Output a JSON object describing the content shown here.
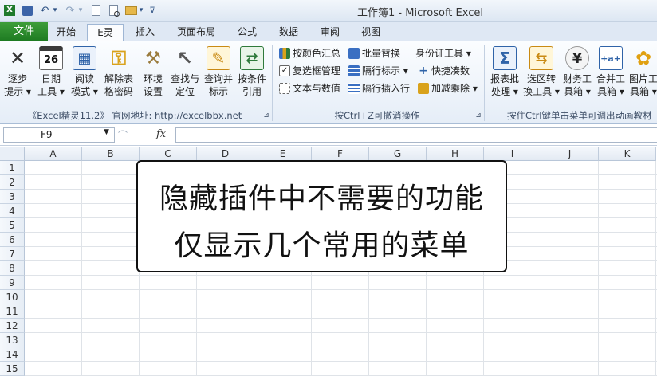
{
  "window": {
    "title": "工作簿1 - Microsoft Excel"
  },
  "quick_access": {
    "dropdown_glyph": "▾"
  },
  "tabs": [
    {
      "id": "file",
      "label": "文件"
    },
    {
      "id": "home",
      "label": "开始"
    },
    {
      "id": "elite",
      "label": "E灵"
    },
    {
      "id": "insert",
      "label": "插入"
    },
    {
      "id": "layout",
      "label": "页面布局"
    },
    {
      "id": "formula",
      "label": "公式"
    },
    {
      "id": "data",
      "label": "数据"
    },
    {
      "id": "review",
      "label": "审阅"
    },
    {
      "id": "view",
      "label": "视图"
    }
  ],
  "ribbon": {
    "big_buttons": [
      {
        "l1": "逐步",
        "l2": "提示 ▾",
        "icon": "x-mark-icon",
        "glyph": "✕",
        "color": "#333333"
      },
      {
        "l1": "日期",
        "l2": "工具 ▾",
        "icon": "calendar-icon",
        "glyph": "26",
        "color": "#333333"
      },
      {
        "l1": "阅读",
        "l2": "模式 ▾",
        "icon": "reading-icon",
        "glyph": "▦",
        "color": "#2f63a8"
      },
      {
        "l1": "解除表",
        "l2": "格密码",
        "icon": "key-icon",
        "glyph": "⚿",
        "color": "#d9a21c"
      },
      {
        "l1": "环境",
        "l2": "设置",
        "icon": "tools-icon",
        "glyph": "⚒",
        "color": "#9a7b3d"
      },
      {
        "l1": "查找与",
        "l2": "定位",
        "icon": "cursor-icon",
        "glyph": "↖",
        "color": "#555555"
      },
      {
        "l1": "查询并",
        "l2": "标示",
        "icon": "pencil-note-icon",
        "glyph": "✎",
        "color": "#c98a13"
      },
      {
        "l1": "按条件",
        "l2": "引用",
        "icon": "reference-icon",
        "glyph": "⇄",
        "color": "#2f7a3b"
      }
    ],
    "small_buttons": [
      {
        "label": "按颜色汇总",
        "icon": "color-sum-icon",
        "color": "#3a6fc2"
      },
      {
        "label": "复选框管理",
        "icon": "checkbox-icon",
        "color": "#ffffff"
      },
      {
        "label": "文本与数值",
        "icon": "text-number-icon",
        "color": "#ffffff"
      },
      {
        "label": "批量替换",
        "icon": "batch-replace-icon",
        "color": "#3a6fc2"
      },
      {
        "label": "隔行标示 ▾",
        "icon": "stripe-rows-icon",
        "color": "#3a6fc2"
      },
      {
        "label": "隔行插入行",
        "icon": "insert-rows-icon",
        "color": "#3a6fc2"
      },
      {
        "label": "身份证工具 ▾",
        "icon": "id-card-icon",
        "color": "transparent"
      },
      {
        "label": "快捷凑数",
        "icon": "quick-sum-icon",
        "color": "#2f63a8"
      },
      {
        "label": "加减乘除 ▾",
        "icon": "arith-icon",
        "color": "#d9a21c"
      }
    ],
    "right_buttons": [
      {
        "l1": "报表批",
        "l2": "处理 ▾",
        "icon": "sigma-icon",
        "glyph": "Σ",
        "color": "#2f63a8"
      },
      {
        "l1": "选区转",
        "l2": "换工具 ▾",
        "icon": "convert-icon",
        "glyph": "⇆",
        "color": "#c98a13"
      },
      {
        "l1": "财务工",
        "l2": "具箱 ▾",
        "icon": "yen-icon",
        "glyph": "¥",
        "color": "#333333"
      },
      {
        "l1": "合并工",
        "l2": "具箱 ▾",
        "icon": "merge-icon",
        "glyph": "+a+",
        "color": "#2f63a8"
      },
      {
        "l1": "图片工",
        "l2": "具箱 ▾",
        "icon": "sunflower-icon",
        "glyph": "✿",
        "color": "#e0a010"
      }
    ],
    "group_labels": {
      "left": "《Excel精灵11.2》 官网地址: http://excelbbx.net",
      "middle": "按Ctrl+Z可撤消操作",
      "right": "按住Ctrl键单击菜单可调出动画教材"
    }
  },
  "formula_bar": {
    "cell_ref": "F9",
    "fx": "fx",
    "value": ""
  },
  "grid": {
    "columns": [
      "A",
      "B",
      "C",
      "D",
      "E",
      "F",
      "G",
      "H",
      "I",
      "J",
      "K"
    ],
    "rows": [
      "1",
      "2",
      "3",
      "4",
      "5",
      "6",
      "7",
      "8",
      "9",
      "10",
      "11",
      "12",
      "13",
      "14",
      "15"
    ]
  },
  "overlay": {
    "line1": "隐藏插件中不需要的功能",
    "line2": "仅显示几个常用的菜单"
  }
}
